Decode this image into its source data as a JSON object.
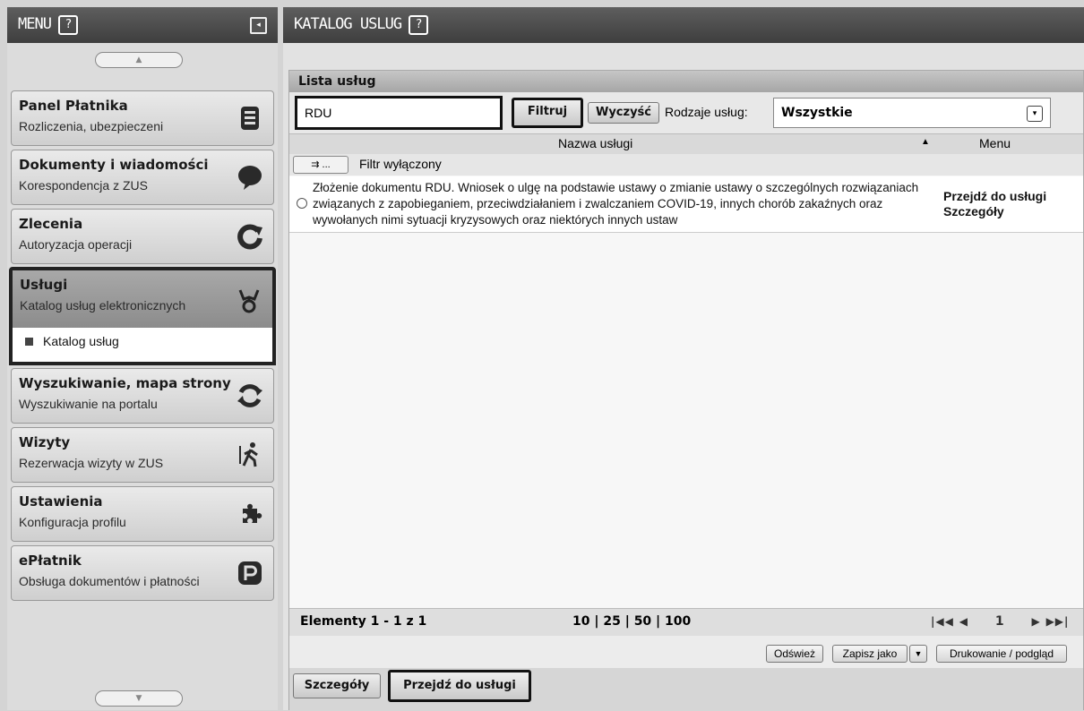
{
  "sidebar": {
    "title": "MENU",
    "help": "?",
    "collapse": "◂",
    "scroll_up": "▲",
    "scroll_down": "▼",
    "items": [
      {
        "title": "Panel Płatnika",
        "subtitle": "Rozliczenia, ubezpieczeni",
        "icon": "document-icon"
      },
      {
        "title": "Dokumenty i wiadomości",
        "subtitle": "Korespondencja z ZUS",
        "icon": "speech-bubble-icon"
      },
      {
        "title": "Zlecenia",
        "subtitle": "Autoryzacja operacji",
        "icon": "refresh-icon"
      },
      {
        "title": "Usługi",
        "subtitle": "Katalog usług elektronicznych",
        "icon": "services-icon"
      },
      {
        "title": "Wyszukiwanie, mapa strony",
        "subtitle": "Wyszukiwanie na portalu",
        "icon": "sync-icon"
      },
      {
        "title": "Wizyty",
        "subtitle": "Rezerwacja wizyty w ZUS",
        "icon": "walking-person-icon"
      },
      {
        "title": "Ustawienia",
        "subtitle": "Konfiguracja profilu",
        "icon": "puzzle-icon"
      },
      {
        "title": "ePłatnik",
        "subtitle": "Obsługa dokumentów i płatności",
        "icon": "p-letter-icon"
      }
    ],
    "submenu": {
      "label": "Katalog usług"
    }
  },
  "main": {
    "title": "KATALOG USLUG",
    "help": "?",
    "panel_title": "Lista usług",
    "search": {
      "value": "RDU"
    },
    "filter_button": "Filtruj",
    "clear_button": "Wyczyść",
    "types_label": "Rodzaje usług:",
    "types_value": "Wszystkie",
    "columns": {
      "name": "Nazwa usługi",
      "menu": "Menu"
    },
    "filter_toggle": "⇉ ...",
    "filter_status": "Filtr wyłączony",
    "rows": [
      {
        "description": "Złożenie dokumentu RDU. Wniosek o ulgę na podstawie ustawy o zmianie ustawy o szczególnych rozwiązaniach związanych z zapobieganiem, przeciwdziałaniem i zwalczaniem COVID-19, innych chorób zakaźnych oraz wywołanych nimi sytuacji kryzysowych oraz niektórych innych ustaw",
        "go_label": "Przejdź do usługi",
        "details_label": "Szczegóły"
      }
    ],
    "pager": {
      "count": "Elementy 1 - 1 z 1",
      "sizes": "10 | 25 | 50 | 100",
      "first": "|◀◀",
      "prev": "◀",
      "page": "1",
      "next": "▶",
      "last": "▶▶|"
    },
    "actions": {
      "refresh": "Odśwież",
      "save_as": "Zapisz jako",
      "save_dropdown": "▼",
      "print": "Drukowanie / podgląd"
    },
    "bottom": {
      "details": "Szczegóły",
      "go": "Przejdź do usługi"
    }
  }
}
